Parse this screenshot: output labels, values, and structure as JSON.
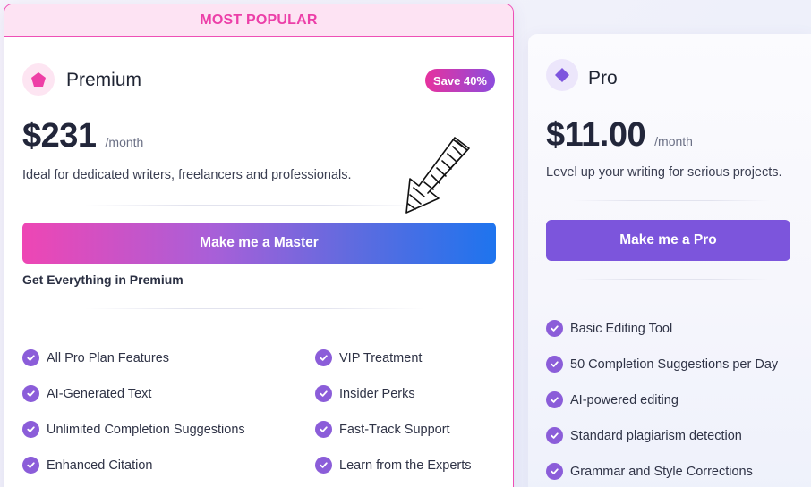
{
  "premium": {
    "banner": "MOST POPULAR",
    "name": "Premium",
    "icon": "pentagon-icon",
    "badge": "Save 40%",
    "price": "$231",
    "period": "/month",
    "description": "Ideal for dedicated writers, freelancers and professionals.",
    "cta": "Make me a Master",
    "includes_label": "Get Everything in Premium",
    "features_left": [
      "All Pro Plan Features",
      "AI-Generated Text",
      "Unlimited Completion Suggestions",
      "Enhanced Citation"
    ],
    "features_right": [
      "VIP Treatment",
      "Insider Perks",
      "Fast-Track Support",
      "Learn from the Experts"
    ]
  },
  "pro": {
    "name": "Pro",
    "icon": "diamond-icon",
    "price": "$11.00",
    "period": "/month",
    "description": "Level up your writing for serious projects.",
    "cta": "Make me a Pro",
    "features": [
      "Basic Editing Tool",
      "50 Completion Suggestions per Day",
      "AI-powered editing",
      "Standard plagiarism detection",
      "Grammar and Style Corrections"
    ]
  },
  "colors": {
    "accent_pink": "#ec3fa8",
    "accent_purple": "#7c55dc",
    "check": "#8b5dd9",
    "gradient_start": "#ee46b4",
    "gradient_end": "#1e74ee"
  }
}
